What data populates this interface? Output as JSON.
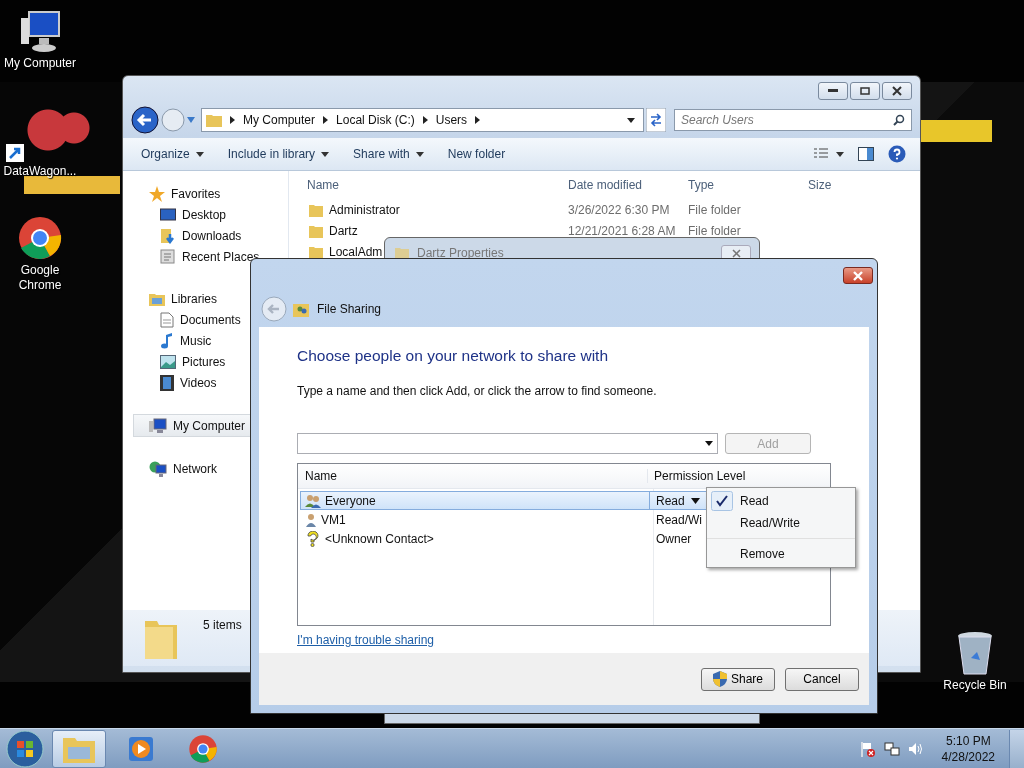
{
  "desktop_icons": [
    {
      "label": "My Computer",
      "kind": "computer"
    },
    {
      "label": "DataWagon...",
      "kind": "shortcut"
    },
    {
      "label": "Google Chrome",
      "kind": "chrome"
    },
    {
      "label": "Recycle Bin",
      "kind": "recycle"
    }
  ],
  "explorer": {
    "breadcrumb": [
      "My Computer",
      "Local Disk (C:)",
      "Users"
    ],
    "search": {
      "placeholder": "Search Users"
    },
    "toolbar": [
      {
        "label": "Organize",
        "dropdown": true
      },
      {
        "label": "Include in library",
        "dropdown": true
      },
      {
        "label": "Share with",
        "dropdown": true
      },
      {
        "label": "New folder",
        "dropdown": false
      }
    ],
    "sidebar": [
      {
        "label": "Favorites",
        "kind": "star",
        "selected": false,
        "children": [
          {
            "label": "Desktop",
            "kind": "monitor",
            "selected": false
          },
          {
            "label": "Downloads",
            "kind": "download",
            "selected": false
          },
          {
            "label": "Recent Places",
            "kind": "recent",
            "selected": false
          }
        ]
      },
      {
        "label": "Libraries",
        "kind": "library",
        "selected": false,
        "children": [
          {
            "label": "Documents",
            "kind": "document",
            "selected": false
          },
          {
            "label": "Music",
            "kind": "music",
            "selected": false
          },
          {
            "label": "Pictures",
            "selected": false
          },
          {
            "label": "Videos",
            "kind": "film",
            "selected": false
          }
        ]
      },
      {
        "label": "My Computer",
        "kind": "monitor",
        "selected": true
      },
      {
        "label": "Network",
        "kind": "globe",
        "selected": false
      }
    ],
    "columns": [
      "Name",
      "Date modified",
      "Type",
      "Size"
    ],
    "rows": [
      {
        "name": "Administrator",
        "date": "3/26/2022 6:30 PM",
        "type": "File folder"
      },
      {
        "name": "Dartz",
        "date": "12/21/2021 6:28 AM",
        "type": "File folder"
      },
      {
        "name": "LocalAdm"
      }
    ],
    "status": "5 items"
  },
  "background_window": {
    "title": "Dartz Properties"
  },
  "dialog": {
    "title": "File Sharing",
    "heading": "Choose people on your network to share with",
    "instruction": "Type a name and then click Add, or click the arrow to find someone.",
    "add_button": {
      "label": "Add",
      "disabled": true
    },
    "columns": [
      "Name",
      "Permission Level"
    ],
    "people": [
      {
        "name": "Everyone",
        "kind": "group",
        "permission": "Read",
        "selected": true,
        "dropdown": true
      },
      {
        "name": "VM1",
        "kind": "user",
        "permission": "Read/Wi",
        "selected": false,
        "dropdown": false
      },
      {
        "name": "<Unknown Contact>",
        "kind": "unknown",
        "permission": "Owner",
        "selected": false,
        "dropdown": false
      }
    ],
    "menu": [
      {
        "label": "Read",
        "checked": true,
        "separator_before": false
      },
      {
        "label": "Read/Write",
        "checked": false,
        "separator_before": false
      },
      {
        "label": "Remove",
        "checked": false,
        "separator_before": true
      }
    ],
    "help_link": "I'm having trouble sharing",
    "buttons": [
      {
        "label": "Share",
        "kind": "shield"
      },
      {
        "label": "Cancel",
        "kind": "plain"
      }
    ]
  },
  "taskbar": {
    "apps": [
      {
        "kind": "explorer",
        "selected": true
      },
      {
        "kind": "media",
        "selected": false
      },
      {
        "kind": "chrome",
        "selected": false
      }
    ],
    "time": "5:10 PM",
    "date": "4/28/2022"
  }
}
